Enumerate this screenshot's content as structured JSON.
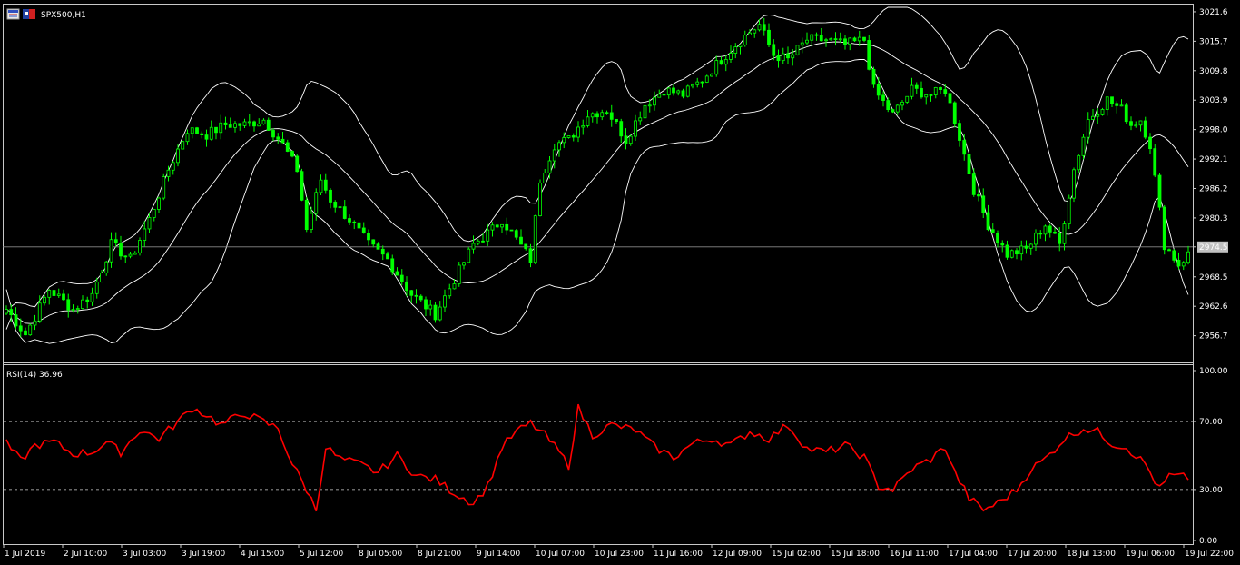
{
  "window": {
    "symbol_label": "SPX500,H1",
    "icons": [
      "chart-window-icon",
      "symbol-flag-icon"
    ]
  },
  "colors": {
    "background": "#000000",
    "candle": "#00ff00",
    "bands": "#ffffff",
    "rsi_line": "#ff0000",
    "grid_dashed": "#cfcfcf",
    "price_tag_bg": "#c0c0c0",
    "axis_text": "#ffffff"
  },
  "chart_data": [
    {
      "type": "candlestick",
      "title": "SPX500,H1",
      "overlays": [
        "Bollinger Bands (upper, middle, lower)"
      ],
      "y_ticks": [
        "3021.6",
        "3015.7",
        "3009.8",
        "3003.9",
        "2998.0",
        "2992.1",
        "2986.2",
        "2980.3",
        "2974.5",
        "2968.5",
        "2962.6",
        "2956.7"
      ],
      "ylim": [
        2951.9,
        3022.5
      ],
      "current_price": "2974.5",
      "series": {
        "close_key_points": [
          [
            0,
            2962
          ],
          [
            4,
            2957
          ],
          [
            9,
            2966
          ],
          [
            14,
            2962
          ],
          [
            18,
            2965
          ],
          [
            22,
            2975
          ],
          [
            26,
            2972
          ],
          [
            30,
            2980
          ],
          [
            34,
            2990
          ],
          [
            38,
            2998
          ],
          [
            42,
            2997
          ],
          [
            46,
            2999
          ],
          [
            50,
            2999
          ],
          [
            54,
            3000
          ],
          [
            58,
            2995
          ],
          [
            61,
            2990
          ],
          [
            63,
            2978
          ],
          [
            66,
            2988
          ],
          [
            68,
            2984
          ],
          [
            72,
            2980
          ],
          [
            76,
            2975
          ],
          [
            80,
            2972
          ],
          [
            85,
            2965
          ],
          [
            90,
            2961
          ],
          [
            94,
            2968
          ],
          [
            98,
            2975
          ],
          [
            102,
            2978
          ],
          [
            104,
            2980
          ],
          [
            107,
            2976
          ],
          [
            110,
            2972
          ],
          [
            112,
            2988
          ],
          [
            115,
            2995
          ],
          [
            118,
            2996
          ],
          [
            122,
            3001
          ],
          [
            126,
            3002
          ],
          [
            130,
            2996
          ],
          [
            134,
            3003
          ],
          [
            138,
            3006
          ],
          [
            142,
            3005
          ],
          [
            146,
            3008
          ],
          [
            150,
            3012
          ],
          [
            154,
            3016
          ],
          [
            158,
            3019
          ],
          [
            161,
            3013
          ],
          [
            164,
            3012
          ],
          [
            168,
            3016
          ],
          [
            172,
            3016
          ],
          [
            176,
            3015
          ],
          [
            180,
            3016
          ],
          [
            182,
            3006
          ],
          [
            186,
            3001
          ],
          [
            190,
            3006
          ],
          [
            194,
            3005
          ],
          [
            197,
            3006
          ],
          [
            199,
            3000
          ],
          [
            203,
            2986
          ],
          [
            206,
            2979
          ],
          [
            210,
            2973
          ],
          [
            214,
            2974
          ],
          [
            218,
            2979
          ],
          [
            221,
            2975
          ],
          [
            224,
            2990
          ],
          [
            227,
            3000
          ],
          [
            231,
            3004
          ],
          [
            234,
            3002
          ],
          [
            236,
            2999
          ],
          [
            238,
            3000
          ],
          [
            240,
            2995
          ],
          [
            243,
            2975
          ],
          [
            246,
            2971
          ],
          [
            248,
            2973
          ]
        ],
        "n_bars": 249,
        "bands_note": "upper/middle/lower Bollinger Bands derived from close prices"
      }
    },
    {
      "type": "line",
      "title": "RSI(14) 36.96",
      "y_ticks": [
        "100.00",
        "70.00",
        "30.00",
        "0.00"
      ],
      "ylim": [
        0,
        100
      ],
      "levels": [
        70,
        30
      ],
      "series": [
        {
          "key_points": [
            [
              0,
              57
            ],
            [
              3,
              47
            ],
            [
              6,
              56
            ],
            [
              10,
              58
            ],
            [
              14,
              51
            ],
            [
              18,
              52
            ],
            [
              21,
              58
            ],
            [
              24,
              52
            ],
            [
              28,
              65
            ],
            [
              32,
              60
            ],
            [
              36,
              70
            ],
            [
              39,
              78
            ],
            [
              42,
              74
            ],
            [
              45,
              68
            ],
            [
              50,
              75
            ],
            [
              53,
              71
            ],
            [
              57,
              66
            ],
            [
              60,
              45
            ],
            [
              63,
              30
            ],
            [
              65,
              18
            ],
            [
              67,
              55
            ],
            [
              70,
              48
            ],
            [
              74,
              45
            ],
            [
              78,
              40
            ],
            [
              82,
              50
            ],
            [
              86,
              38
            ],
            [
              90,
              36
            ],
            [
              94,
              28
            ],
            [
              98,
              22
            ],
            [
              101,
              32
            ],
            [
              104,
              55
            ],
            [
              107,
              64
            ],
            [
              110,
              69
            ],
            [
              113,
              62
            ],
            [
              116,
              52
            ],
            [
              118,
              44
            ],
            [
              120,
              78
            ],
            [
              123,
              62
            ],
            [
              127,
              68
            ],
            [
              132,
              65
            ],
            [
              136,
              55
            ],
            [
              140,
              49
            ],
            [
              144,
              57
            ],
            [
              148,
              60
            ],
            [
              152,
              56
            ],
            [
              156,
              64
            ],
            [
              160,
              60
            ],
            [
              164,
              68
            ],
            [
              168,
              54
            ],
            [
              172,
              52
            ],
            [
              176,
              56
            ],
            [
              180,
              49
            ],
            [
              183,
              32
            ],
            [
              186,
              30
            ],
            [
              190,
              42
            ],
            [
              194,
              48
            ],
            [
              197,
              55
            ],
            [
              199,
              40
            ],
            [
              202,
              25
            ],
            [
              205,
              18
            ],
            [
              208,
              22
            ],
            [
              212,
              30
            ],
            [
              215,
              42
            ],
            [
              218,
              48
            ],
            [
              222,
              60
            ],
            [
              226,
              66
            ],
            [
              229,
              64
            ],
            [
              232,
              57
            ],
            [
              235,
              55
            ],
            [
              239,
              45
            ],
            [
              242,
              30
            ],
            [
              244,
              38
            ],
            [
              248,
              37
            ]
          ]
        }
      ]
    }
  ],
  "x_axis": {
    "labels": [
      "1 Jul 2019",
      "2 Jul 10:00",
      "3 Jul 03:00",
      "3 Jul 19:00",
      "4 Jul 15:00",
      "5 Jul 12:00",
      "8 Jul 05:00",
      "8 Jul 21:00",
      "9 Jul 14:00",
      "10 Jul 07:00",
      "10 Jul 23:00",
      "11 Jul 16:00",
      "12 Jul 09:00",
      "15 Jul 02:00",
      "15 Jul 18:00",
      "16 Jul 11:00",
      "17 Jul 04:00",
      "17 Jul 20:00",
      "18 Jul 13:00",
      "19 Jul 06:00",
      "19 Jul 22:00"
    ]
  }
}
